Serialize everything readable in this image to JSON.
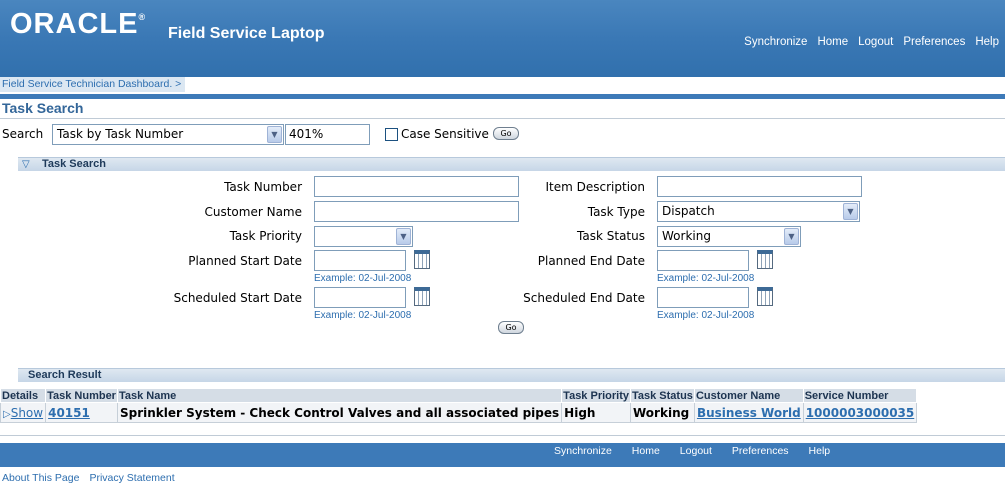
{
  "header": {
    "logo": "ORACLE",
    "app_name": "Field Service Laptop",
    "nav": [
      "Synchronize",
      "Home",
      "Logout",
      "Preferences",
      "Help"
    ]
  },
  "breadcrumb": "Field Service Technician Dashboard.  >",
  "page_title": "Task Search",
  "quick_search": {
    "label": "Search",
    "selected": "Task by Task Number",
    "value": "401%",
    "case_label": "Case Sensitive",
    "case_checked": false,
    "go": "Go"
  },
  "task_search": {
    "title": "Task Search",
    "labels": {
      "task_number": "Task Number",
      "item_description": "Item Description",
      "customer_name": "Customer Name",
      "task_type": "Task Type",
      "task_priority": "Task Priority",
      "task_status": "Task Status",
      "planned_start": "Planned Start Date",
      "planned_end": "Planned End Date",
      "scheduled_start": "Scheduled Start Date",
      "scheduled_end": "Scheduled End Date"
    },
    "values": {
      "task_type": "Dispatch",
      "task_priority": "",
      "task_status": "Working"
    },
    "example": "Example: 02-Jul-2008",
    "go": "Go"
  },
  "results": {
    "title": "Search Result",
    "columns": [
      "Details",
      "Task Number",
      "Task Name",
      "Task Priority",
      "Task Status",
      "Customer Name",
      "Service Number"
    ],
    "rows": [
      {
        "details": "Show",
        "task_number": "40151",
        "task_name": "Sprinkler System - Check Control Valves and all associated pipes",
        "priority": "High",
        "status": "Working",
        "customer": "Business World",
        "service_number": "1000003000035"
      }
    ]
  },
  "footer": {
    "nav": [
      "Synchronize",
      "Home",
      "Logout",
      "Preferences",
      "Help"
    ],
    "links": [
      "About This Page",
      "Privacy Statement"
    ]
  }
}
